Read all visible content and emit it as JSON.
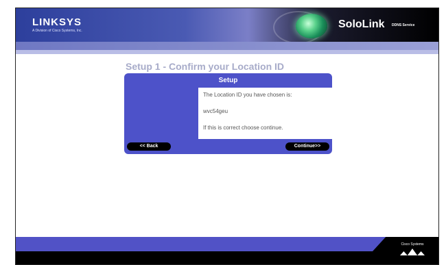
{
  "header": {
    "brand": "LINKSYS",
    "brand_sub": "A Division of Cisco Systems, Inc.",
    "product": "SoloLink",
    "product_sub": "DDNS Service"
  },
  "page": {
    "title": "Setup 1 - Confirm your Location ID",
    "panel_title": "Setup",
    "line1": "The Location ID you have chosen is:",
    "location_id": "wvc54geu",
    "line3": "If this is correct choose continue."
  },
  "buttons": {
    "back": "<< Back",
    "continue": "Continue>>"
  },
  "footer": {
    "cisco_label": "Cisco Systems"
  },
  "colors": {
    "panel": "#4d52c9",
    "footer": "#5152c6"
  }
}
